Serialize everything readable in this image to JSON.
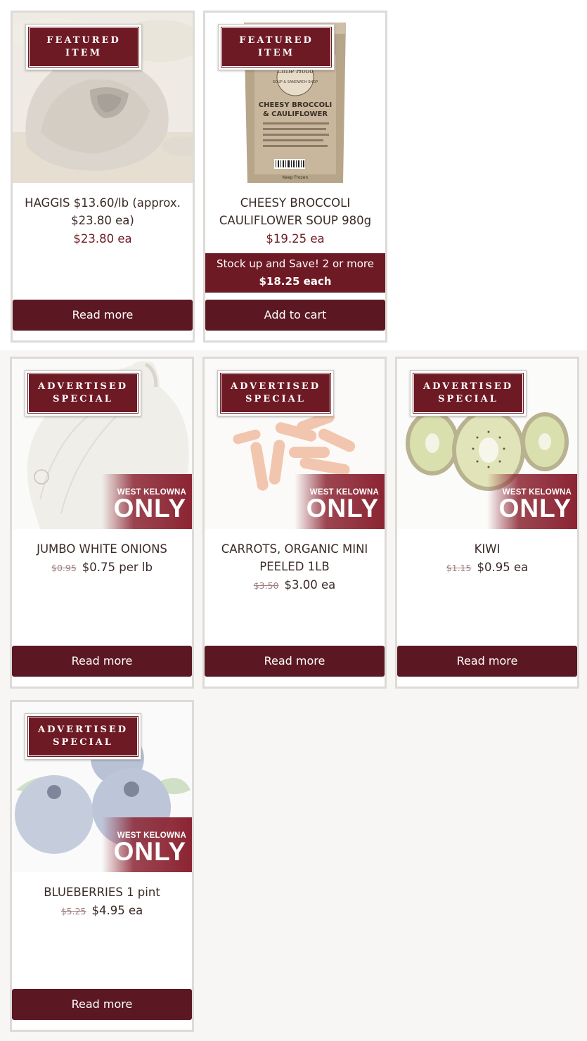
{
  "colors": {
    "accent": "#6e1a24",
    "button": "#5c1822",
    "border": "#dddbd8",
    "background": "#f7f6f4"
  },
  "featured": [
    {
      "badge_line1": "FEATURED",
      "badge_line2": "ITEM",
      "title": "HAGGIS $13.60/lb (approx. $23.80 ea)",
      "price": "$23.80 ea",
      "button": "Read more",
      "image_icon": "haggis-image"
    },
    {
      "badge_line1": "FEATURED",
      "badge_line2": "ITEM",
      "title": "CHEESY BROCCOLI CAULIFLOWER SOUP 980g",
      "price": "$19.25 ea",
      "promo_line1": "Stock up and Save! 2 or more",
      "promo_line2": "$18.25 each",
      "button": "Add to cart",
      "image_icon": "soup-container-image",
      "label": {
        "brand": "Little Hobo",
        "sub": "SOUP & SANDWICH SHOP",
        "name1": "CHEESY BROCCOLI",
        "name2": "& CAULIFLOWER",
        "note": "Keep Frozen"
      }
    }
  ],
  "specials": [
    {
      "badge_line1": "ADVERTISED",
      "badge_line2": "SPECIAL",
      "title": "JUMBO WHITE ONIONS",
      "old_price": "$0.95",
      "price": "$0.75 per lb",
      "button": "Read more",
      "ribbon_city": "WEST KELOWNA",
      "ribbon_only": "ONLY",
      "image_icon": "onion-image"
    },
    {
      "badge_line1": "ADVERTISED",
      "badge_line2": "SPECIAL",
      "title": "CARROTS, ORGANIC MINI PEELED 1LB",
      "old_price": "$3.50",
      "price": "$3.00 ea",
      "button": "Read more",
      "ribbon_city": "WEST KELOWNA",
      "ribbon_only": "ONLY",
      "image_icon": "carrots-image"
    },
    {
      "badge_line1": "ADVERTISED",
      "badge_line2": "SPECIAL",
      "title": "KIWI",
      "old_price": "$1.15",
      "price": "$0.95 ea",
      "button": "Read more",
      "ribbon_city": "WEST KELOWNA",
      "ribbon_only": "ONLY",
      "image_icon": "kiwi-image"
    },
    {
      "badge_line1": "ADVERTISED",
      "badge_line2": "SPECIAL",
      "title": "BLUEBERRIES 1 pint",
      "old_price": "$5.25",
      "price": "$4.95 ea",
      "button": "Read more",
      "ribbon_city": "WEST KELOWNA",
      "ribbon_only": "ONLY",
      "image_icon": "blueberries-image"
    }
  ]
}
